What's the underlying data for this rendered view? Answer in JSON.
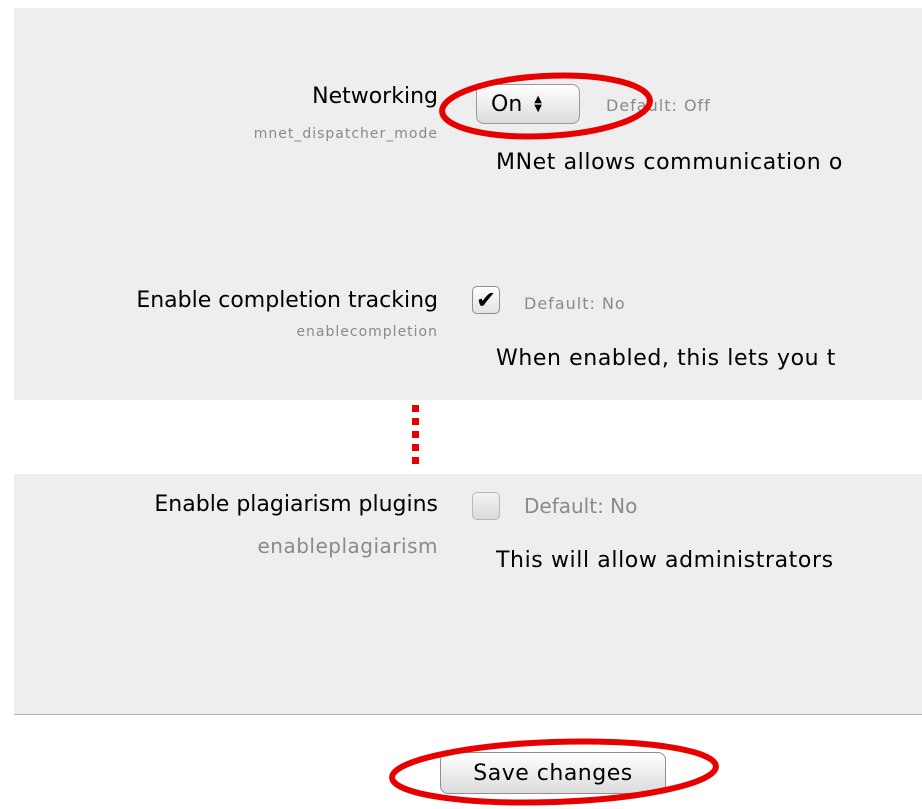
{
  "settings": [
    {
      "label": "Networking",
      "key": "mnet_dispatcher_mode",
      "control": "select",
      "value": "On",
      "default": "Default: Off",
      "description": "MNet allows communication o"
    },
    {
      "label": "Enable completion tracking",
      "key": "enablecompletion",
      "control": "checkbox",
      "checked": true,
      "default": "Default: No",
      "description": "When enabled, this lets you t"
    },
    {
      "label": "Enable plagiarism plugins",
      "key": "enableplagiarism",
      "control": "checkbox",
      "checked": false,
      "default": "Default: No",
      "description": "This will allow administrators"
    }
  ],
  "footer": {
    "save_label": "Save changes"
  },
  "icons": {
    "select_chevron": "chevron-up-down-icon",
    "check": "checkmark-icon"
  },
  "colors": {
    "annotation": "#e80000",
    "panel": "#eeeeee",
    "key_text": "#8a8a8a"
  }
}
